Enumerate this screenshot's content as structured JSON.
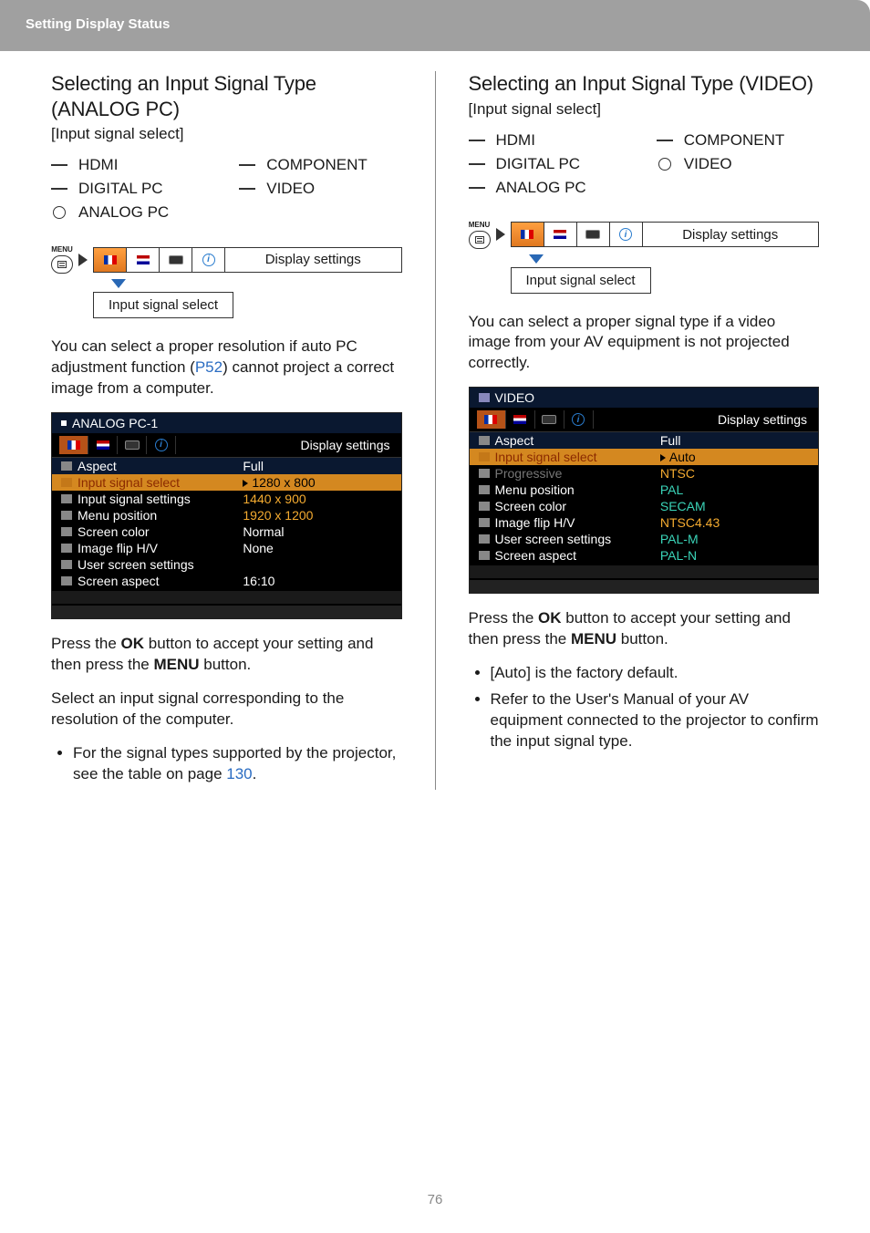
{
  "header": {
    "title": "Setting Display Status"
  },
  "page_number": "76",
  "left": {
    "title": "Selecting an Input Signal Type (ANALOG PC)",
    "subtitle": "[Input signal select]",
    "signals_left": [
      {
        "label": "HDMI",
        "type": "dash"
      },
      {
        "label": "DIGITAL PC",
        "type": "dash"
      },
      {
        "label": "ANALOG PC",
        "type": "circle"
      }
    ],
    "signals_right": [
      {
        "label": "COMPONENT",
        "type": "dash"
      },
      {
        "label": "VIDEO",
        "type": "dash"
      }
    ],
    "menu_label": "MENU",
    "tab_label": "Display settings",
    "callout": "Input signal select",
    "body1a": "You can select a proper resolution if auto PC adjustment function (",
    "body1_link": "P52",
    "body1b": ") cannot project a correct image from a computer.",
    "accept_a": "Press the ",
    "accept_ok": "OK",
    "accept_b": " button to accept your setting and then press the ",
    "accept_menu": "MENU",
    "accept_c": " button.",
    "body2": "Select an input signal corresponding to the resolution of the computer.",
    "bullet_a": "For the signal types supported by the projector, see the table on page ",
    "bullet_link": "130",
    "bullet_b": ".",
    "osd": {
      "title": "ANALOG PC-1",
      "ds": "Display settings",
      "rows": [
        {
          "label": "Aspect",
          "value": "Full",
          "style": "dark"
        },
        {
          "label": "Input signal select",
          "value": "1280 x 800",
          "style": "hl",
          "tri": true
        },
        {
          "label": "Input signal settings",
          "value": "1440 x 900",
          "style": "hl-sub"
        },
        {
          "label": "Menu position",
          "value": "1920 x 1200",
          "style": "hl-sub"
        },
        {
          "label": "Screen color",
          "value": "Normal",
          "style": ""
        },
        {
          "label": "Image flip H/V",
          "value": "None",
          "style": ""
        },
        {
          "label": "User screen settings",
          "value": "",
          "style": ""
        },
        {
          "label": "Screen aspect",
          "value": "16:10",
          "style": ""
        }
      ]
    }
  },
  "right": {
    "title": "Selecting an Input Signal Type (VIDEO)",
    "subtitle": "[Input signal select]",
    "signals_left": [
      {
        "label": "HDMI",
        "type": "dash"
      },
      {
        "label": "DIGITAL PC",
        "type": "dash"
      },
      {
        "label": "ANALOG PC",
        "type": "dash"
      }
    ],
    "signals_right": [
      {
        "label": "COMPONENT",
        "type": "dash"
      },
      {
        "label": "VIDEO",
        "type": "circle"
      }
    ],
    "menu_label": "MENU",
    "tab_label": "Display settings",
    "callout": "Input signal select",
    "body1": "You can select a proper signal type if a video image from your AV equipment is not projected correctly.",
    "accept_a": "Press the ",
    "accept_ok": "OK",
    "accept_b": " button to accept your setting and then press the ",
    "accept_menu": "MENU",
    "accept_c": " button.",
    "bullets": [
      "[Auto] is the factory default.",
      "Refer to the User's Manual of your AV equipment connected to the projector to confirm the input signal type."
    ],
    "osd": {
      "title": "VIDEO",
      "ds": "Display settings",
      "rows": [
        {
          "label": "Aspect",
          "value": "Full",
          "style": "dark"
        },
        {
          "label": "Input signal select",
          "value": "Auto",
          "style": "hl",
          "tri": true
        },
        {
          "label": "Progressive",
          "value": "NTSC",
          "style": "hl-sub",
          "dim": true
        },
        {
          "label": "Menu position",
          "value": "PAL",
          "style": "hl-sub"
        },
        {
          "label": "Screen color",
          "value": "SECAM",
          "style": "hl-sub"
        },
        {
          "label": "Image flip H/V",
          "value": "NTSC4.43",
          "style": "hl-sub"
        },
        {
          "label": "User screen settings",
          "value": "PAL-M",
          "style": "hl-sub"
        },
        {
          "label": "Screen aspect",
          "value": "PAL-N",
          "style": "hl-sub"
        }
      ]
    }
  }
}
